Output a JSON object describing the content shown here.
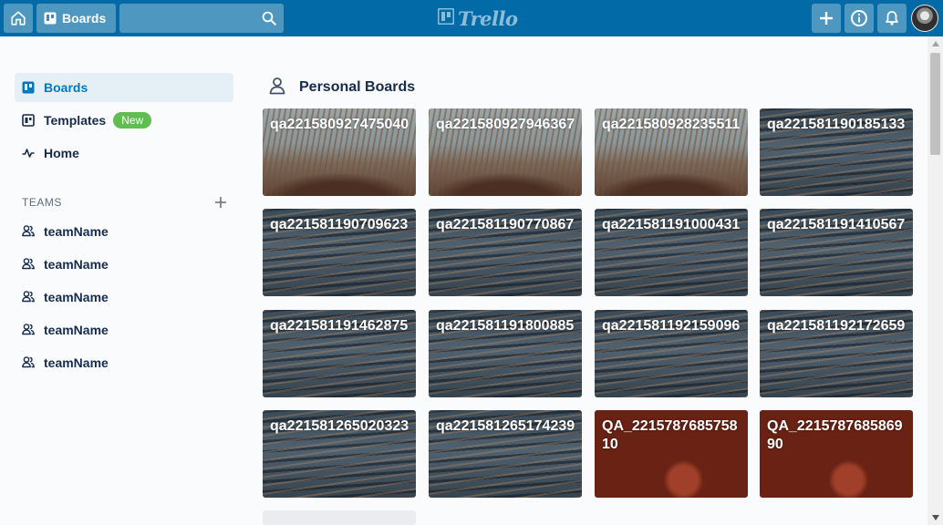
{
  "header": {
    "boards_label": "Boards",
    "search_value": "",
    "search_placeholder": "",
    "logo_text": "Trello",
    "accent": "#026aa7"
  },
  "sidebar": {
    "nav": [
      {
        "label": "Boards",
        "icon": "boards-icon",
        "active": true
      },
      {
        "label": "Templates",
        "icon": "templates-icon",
        "badge": "New"
      },
      {
        "label": "Home",
        "icon": "activity-icon"
      }
    ],
    "teams_title": "TEAMS",
    "teams": [
      {
        "label": "teamName",
        "icon": "team-icon"
      },
      {
        "label": "teamName",
        "icon": "team-icon"
      },
      {
        "label": "teamName",
        "icon": "team-icon"
      },
      {
        "label": "teamName",
        "icon": "team-icon"
      },
      {
        "label": "teamName",
        "icon": "team-icon"
      }
    ]
  },
  "main": {
    "section_title": "Personal Boards",
    "boards": [
      {
        "title": "qa221580927475040",
        "background": "plant"
      },
      {
        "title": "qa221580927946367",
        "background": "plant"
      },
      {
        "title": "qa221580928235511",
        "background": "plant"
      },
      {
        "title": "qa221581190185133",
        "background": "water"
      },
      {
        "title": "qa221581190709623",
        "background": "water"
      },
      {
        "title": "qa221581190770867",
        "background": "water"
      },
      {
        "title": "qa221581191000431",
        "background": "water"
      },
      {
        "title": "qa221581191410567",
        "background": "water"
      },
      {
        "title": "qa221581191462875",
        "background": "water"
      },
      {
        "title": "qa221581191800885",
        "background": "water"
      },
      {
        "title": "qa221581192159096",
        "background": "water"
      },
      {
        "title": "qa221581192172659",
        "background": "water"
      },
      {
        "title": "qa221581265020323",
        "background": "water"
      },
      {
        "title": "qa221581265174239",
        "background": "water"
      },
      {
        "title": "QA_221578768575810",
        "background": "moon"
      },
      {
        "title": "QA_221578768586990",
        "background": "moon"
      }
    ]
  }
}
